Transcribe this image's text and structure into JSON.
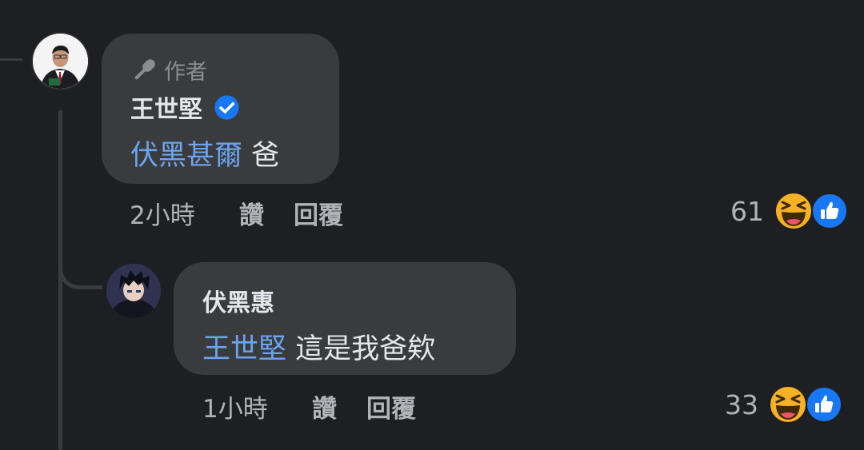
{
  "comment": {
    "author_badge": "作者",
    "author_name": "王世堅",
    "mention": "伏黑甚爾",
    "text": " 爸",
    "time": "2小時",
    "like_label": "讚",
    "reply_label": "回覆",
    "reaction_count": "61",
    "reaction_icons": [
      "haha-icon",
      "like-icon"
    ],
    "verified_icon": "verified-badge-icon"
  },
  "reply": {
    "author_name": "伏黑惠",
    "mention": "王世堅",
    "text": " 這是我爸欸",
    "time": "1小時",
    "like_label": "讚",
    "reply_label": "回覆",
    "reaction_count": "33",
    "reaction_icons": [
      "haha-icon",
      "like-icon"
    ]
  },
  "colors": {
    "background": "#1e1f22",
    "bubble": "#3a3b3c",
    "mention": "#6ba4f0",
    "verified": "#1877f2",
    "haha": "#f7b125"
  }
}
